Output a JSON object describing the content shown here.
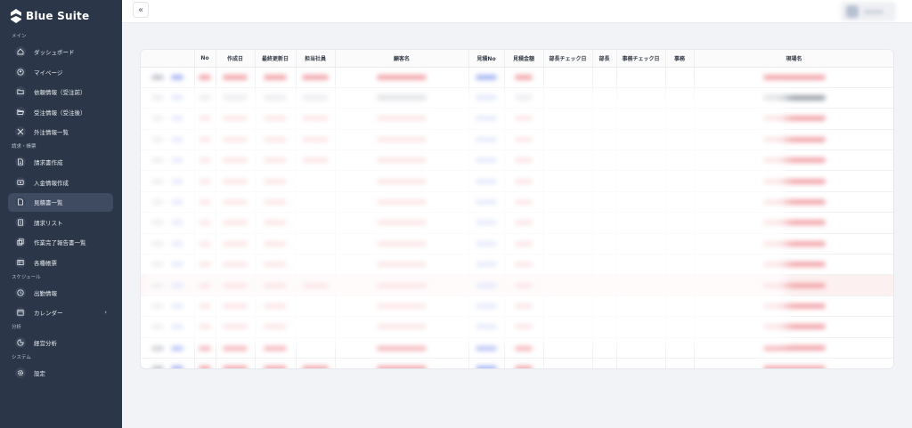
{
  "brand": {
    "name": "Blue Suite"
  },
  "sidebar": {
    "sections": [
      {
        "label": "メイン",
        "items": [
          {
            "label": "ダッシュボード",
            "icon": "home-icon"
          },
          {
            "label": "マイページ",
            "icon": "user-circle-icon"
          },
          {
            "label": "依頼情報（受注前）",
            "icon": "folder-icon"
          },
          {
            "label": "受注情報（受注後）",
            "icon": "folder-open-icon"
          },
          {
            "label": "外注情報一覧",
            "icon": "tools-icon"
          }
        ]
      },
      {
        "label": "請求・帳票",
        "items": [
          {
            "label": "請求書作成",
            "icon": "invoice-icon"
          },
          {
            "label": "入金情報作成",
            "icon": "payment-icon"
          },
          {
            "label": "見積書一覧",
            "icon": "document-icon",
            "active": true
          },
          {
            "label": "請求リスト",
            "icon": "list-icon"
          },
          {
            "label": "作業完了報告書一覧",
            "icon": "copy-icon"
          },
          {
            "label": "各種帳票",
            "icon": "table-icon"
          }
        ]
      },
      {
        "label": "スケジュール",
        "items": [
          {
            "label": "出勤情報",
            "icon": "clock-icon"
          },
          {
            "label": "カレンダー",
            "icon": "calendar-icon",
            "arrow": "›"
          }
        ]
      },
      {
        "label": "分析",
        "items": [
          {
            "label": "経営分析",
            "icon": "chart-pie-icon"
          }
        ]
      },
      {
        "label": "システム",
        "items": [
          {
            "label": "設定",
            "icon": "gear-icon"
          }
        ]
      }
    ]
  },
  "topbar": {
    "collapse_glyph": "«"
  },
  "table": {
    "columns": [
      "",
      "No",
      "作成日",
      "最終更新日",
      "担当社員",
      "顧客名",
      "見積No",
      "見積金額",
      "部長チェック日",
      "部長",
      "事務チェック日",
      "事務",
      "現場名"
    ],
    "rows": [
      {
        "marks": [
          "g",
          "b",
          "r",
          "r",
          "r",
          "r",
          "r",
          "b",
          "r",
          "",
          "",
          "",
          "",
          "r"
        ],
        "highlight": false
      },
      {
        "marks": [
          "g",
          "b",
          "g",
          "g",
          "g",
          "g",
          "d",
          "b",
          "g",
          "",
          "",
          "",
          "",
          "d"
        ],
        "highlight": false
      },
      {
        "marks": [
          "g",
          "b",
          "r",
          "r",
          "r",
          "r",
          "r",
          "b",
          "r",
          "",
          "",
          "",
          "",
          "r"
        ],
        "highlight": false
      },
      {
        "marks": [
          "g",
          "b",
          "r",
          "r",
          "r",
          "r",
          "r",
          "b",
          "r",
          "",
          "",
          "",
          "",
          "r"
        ],
        "highlight": false
      },
      {
        "marks": [
          "g",
          "b",
          "r",
          "r",
          "r",
          "r",
          "r",
          "b",
          "r",
          "",
          "",
          "",
          "",
          "r"
        ],
        "highlight": false
      },
      {
        "marks": [
          "g",
          "b",
          "r",
          "r",
          "r",
          "",
          "r",
          "b",
          "r",
          "",
          "",
          "",
          "",
          "r"
        ],
        "highlight": false
      },
      {
        "marks": [
          "g",
          "b",
          "r",
          "r",
          "r",
          "",
          "r",
          "b",
          "r",
          "",
          "",
          "",
          "",
          "r"
        ],
        "highlight": false
      },
      {
        "marks": [
          "g",
          "b",
          "r",
          "r",
          "r",
          "",
          "r",
          "b",
          "r",
          "",
          "",
          "",
          "",
          "r"
        ],
        "highlight": false
      },
      {
        "marks": [
          "g",
          "b",
          "r",
          "r",
          "r",
          "",
          "r",
          "b",
          "r",
          "",
          "",
          "",
          "",
          "r"
        ],
        "highlight": false
      },
      {
        "marks": [
          "g",
          "b",
          "r",
          "r",
          "r",
          "",
          "r",
          "b",
          "r",
          "",
          "",
          "",
          "",
          "r"
        ],
        "highlight": false
      },
      {
        "marks": [
          "g",
          "b",
          "r",
          "r",
          "r",
          "r",
          "r",
          "b",
          "r",
          "",
          "",
          "",
          "",
          "r"
        ],
        "highlight": true
      },
      {
        "marks": [
          "g",
          "b",
          "r",
          "r",
          "r",
          "",
          "r",
          "b",
          "r",
          "",
          "",
          "",
          "",
          "r"
        ],
        "highlight": false
      },
      {
        "marks": [
          "g",
          "b",
          "r",
          "r",
          "r",
          "",
          "r",
          "b",
          "r",
          "",
          "",
          "",
          "",
          "r"
        ],
        "highlight": false
      },
      {
        "marks": [
          "g",
          "b",
          "r",
          "r",
          "r",
          "",
          "r",
          "b",
          "r",
          "",
          "",
          "",
          "",
          "r"
        ],
        "highlight": false
      },
      {
        "marks": [
          "g",
          "b",
          "r",
          "r",
          "r",
          "r",
          "r",
          "b",
          "r",
          "",
          "",
          "",
          "",
          "r"
        ],
        "highlight": false
      }
    ]
  },
  "colors": {
    "sidebar_bg": "#2b3648",
    "active_item": "#3e4b61",
    "page_bg": "#f1f3f7",
    "accent_red": "#f2a7ac",
    "accent_blue": "#aab8f4",
    "highlight_row": "#fdf0f1"
  }
}
